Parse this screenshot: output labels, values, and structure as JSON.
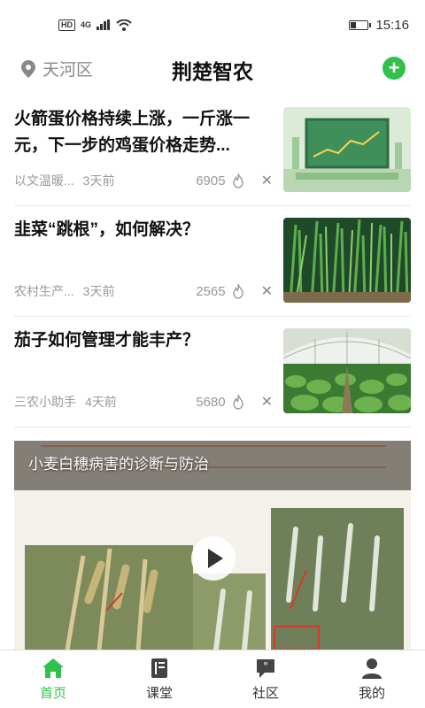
{
  "status": {
    "network": "4G",
    "time": "15:16",
    "battery_level": 0.3
  },
  "header": {
    "location": "天河区",
    "title": "荆楚智农",
    "add_icon": "plus-circle-icon"
  },
  "articles": [
    {
      "title": "火箭蛋价格持续上涨，一斤涨一元，下一步的鸡蛋价格走势...",
      "source": "以文温暖...",
      "time": "3天前",
      "views": "6905"
    },
    {
      "title": "韭菜“跳根”，如何解决？",
      "source": "农村生产...",
      "time": "3天前",
      "views": "2565"
    },
    {
      "title": "茄子如何管理才能丰产？",
      "source": "三农小助手",
      "time": "4天前",
      "views": "5680"
    }
  ],
  "video": {
    "title": "小麦白穗病害的诊断与防治"
  },
  "tabs": [
    {
      "label": "首页",
      "icon": "home-icon",
      "active": true
    },
    {
      "label": "课堂",
      "icon": "book-icon",
      "active": false
    },
    {
      "label": "社区",
      "icon": "chat-icon",
      "active": false
    },
    {
      "label": "我的",
      "icon": "user-icon",
      "active": false
    }
  ],
  "colors": {
    "accent": "#2fc14a"
  }
}
